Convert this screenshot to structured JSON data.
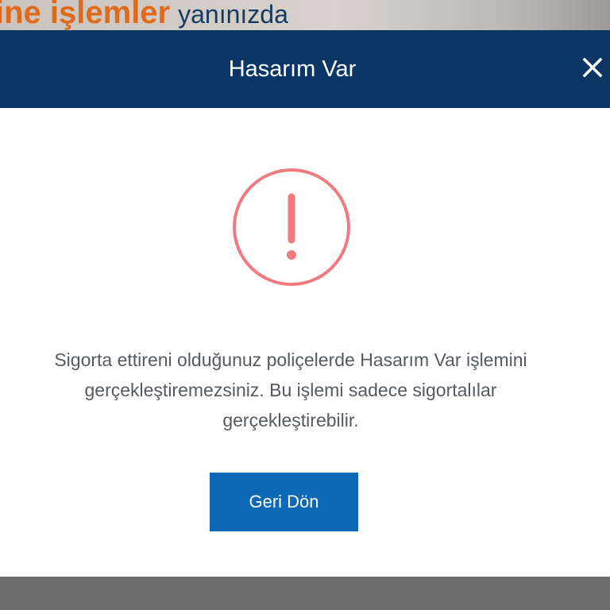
{
  "background": {
    "banner_highlight": "ine işlemler",
    "banner_rest": "yanınızda"
  },
  "modal": {
    "title": "Hasarım Var",
    "close_icon": "close-icon",
    "alert_icon": "exclamation-circle-icon",
    "message": "Sigorta ettireni olduğunuz poliçelerde Hasarım Var işlemini gerçekleştiremezsiniz. Bu işlemi sadece sigortalılar gerçekleştirebilir.",
    "back_button_label": "Geri Dön"
  },
  "colors": {
    "header_bg": "#0a3564",
    "button_bg": "#0d68b5",
    "alert": "#f07a80",
    "overlay": "#6f6f6f",
    "brand_orange": "#e06a1b"
  }
}
